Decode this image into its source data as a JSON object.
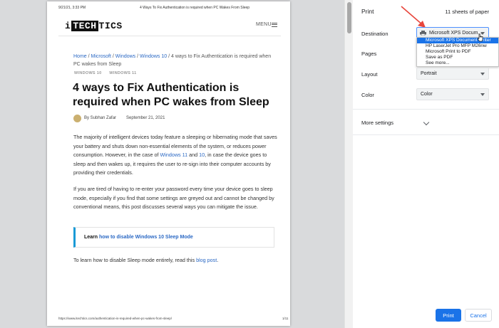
{
  "preview": {
    "header_date": "9/21/21, 3:33 PM",
    "header_title": "4 Ways To Fix Authentication is required when PC Wakes From Sleep",
    "logo_i": "i",
    "logo_tech": "TECH",
    "logo_tics": "TICS",
    "menu_label": "MENU",
    "breadcrumb": {
      "home": "Home",
      "microsoft": "Microsoft",
      "windows": "Windows",
      "windows10": "Windows 10",
      "sep": " / ",
      "current": "4 ways to Fix Authentication is required when PC wakes from Sleep"
    },
    "tags": [
      "WINDOWS 10",
      "WINDOWS 11"
    ],
    "article_title": "4 ways to Fix Authentication is required when PC wakes from Sleep",
    "author": "By Subhan Zafar",
    "date": "September 21, 2021",
    "p1_a": "The majority of intelligent devices today feature a sleeping or hibernating mode that saves your battery and shuts down non-essential elements of the system, or reduces power consumption. However, in the case of ",
    "p1_link1": "Windows 11",
    "p1_and": " and ",
    "p1_link2": "10",
    "p1_b": ", in case the device goes to sleep and then wakes up, it requires the user to re-sign into their computer accounts by providing their credentials.",
    "p2": "If you are tired of having to re-enter your password every time your device goes to sleep mode, especially if you find that some settings are greyed out and cannot be changed by conventional means, this post discusses several ways you can mitigate the issue.",
    "callout_prefix": "Learn ",
    "callout_link": "how to disable Windows 10 Sleep Mode",
    "p3_a": "To learn how to disable Sleep mode entirely, read this ",
    "p3_link": "blog post",
    "p3_b": ".",
    "footer_url": "https://www.itechtics.com/authentication-is-required-when-pc-wakes-from-sleep/",
    "footer_page": "1/11"
  },
  "panel": {
    "title": "Print",
    "sheet_count": "11 sheets of paper",
    "destination_label": "Destination",
    "destination_value": "Microsoft XPS Docum...",
    "destination_options": [
      "Microsoft XPS Document Writer",
      "HP LaserJet Pro MFP M26nw",
      "Microsoft Print to PDF",
      "Save as PDF",
      "See more..."
    ],
    "pages_label": "Pages",
    "layout_label": "Layout",
    "layout_value": "Portrait",
    "color_label": "Color",
    "color_value": "Color",
    "more_settings": "More settings",
    "print_button": "Print",
    "cancel_button": "Cancel"
  },
  "colors": {
    "accent": "#1a73e8",
    "annotation_arrow": "#e8463c"
  }
}
